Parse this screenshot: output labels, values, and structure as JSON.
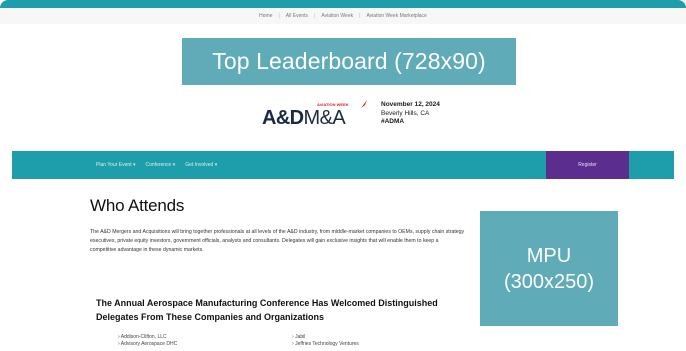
{
  "util_nav": {
    "items": [
      "Home",
      "All Events",
      "Aviation Week",
      "Aviation Week Marketplace"
    ]
  },
  "ads": {
    "leaderboard": "Top Leaderboard (728x90)",
    "mpu_line1": "MPU",
    "mpu_line2": "(300x250)"
  },
  "logo": {
    "brand_small": "AVIATION WEEK",
    "brand_main_bold": "A&D",
    "brand_main_rest": "M&A"
  },
  "event": {
    "date": "November 12, 2024",
    "location": "Beverly Hills, CA",
    "hashtag": "#ADMA"
  },
  "main_nav": {
    "items": [
      "Plan Your Event ▾",
      "Conference ▾",
      "Get Involved ▾"
    ],
    "register": "Register"
  },
  "content": {
    "title": "Who Attends",
    "intro": "The A&D Mergers and Acquisitions will bring together professionals at all levels of the A&D industry, from middle-market companies to OEMs, supply chain strategy executives, private equity investors, government officials, analysts and consultants. Delegates will gain exclusive insights that will enable them to keep a competitive advantage in these dynamic markets.",
    "subhead": "The Annual Aerospace Manufacturing Conference Has Welcomed Distinguished Delegates From These Companies and Organizations",
    "list_left": [
      "Addison-Clifton, LLC",
      "Advisory Aerospace DHC"
    ],
    "list_right": [
      "Jabil",
      "Jeffries Technology Ventures"
    ]
  },
  "colors": {
    "teal": "#1e9eaa",
    "ad_placeholder": "#5fabb7",
    "register_purple": "#5b2d8e",
    "brand_red": "#d21e28",
    "brand_navy": "#1a2a44"
  }
}
